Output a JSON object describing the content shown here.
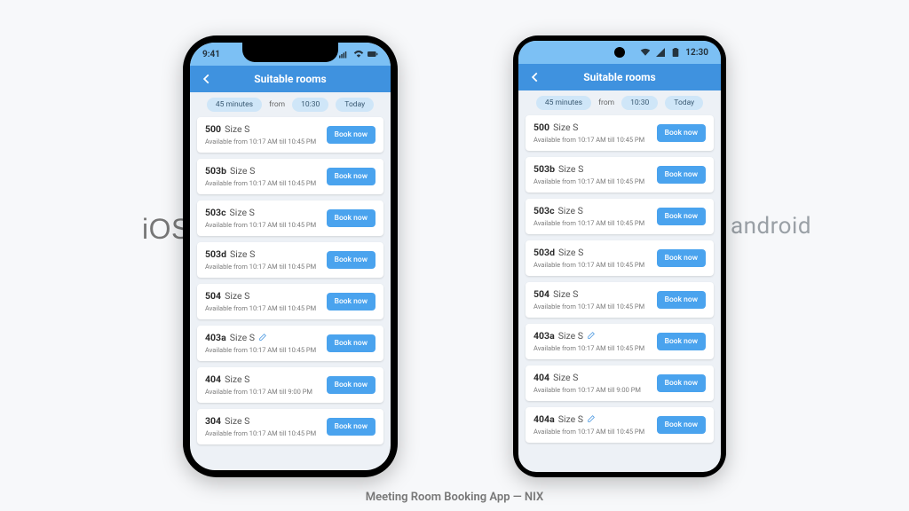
{
  "caption": "Meeting Room Booking App — NIX",
  "platforms": {
    "ios": "iOS",
    "android": "android"
  },
  "ios_status": {
    "time": "9:41"
  },
  "android_status": {
    "time": "12:30"
  },
  "navbar": {
    "title": "Suitable rooms"
  },
  "filters": {
    "duration": "45 minutes",
    "from_label": "from",
    "time": "10:30",
    "day": "Today"
  },
  "book_label": "Book now",
  "rooms_ios": [
    {
      "num": "500",
      "size": "Size S",
      "sub": "Available from 10:17 AM till 10:45 PM",
      "editable": false
    },
    {
      "num": "503b",
      "size": "Size S",
      "sub": "Available from 10:17 AM till 10:45 PM",
      "editable": false
    },
    {
      "num": "503c",
      "size": "Size S",
      "sub": "Available from 10:17 AM till 10:45 PM",
      "editable": false
    },
    {
      "num": "503d",
      "size": "Size S",
      "sub": "Available from 10:17 AM till 10:45 PM",
      "editable": false
    },
    {
      "num": "504",
      "size": "Size S",
      "sub": "Available from 10:17 AM till 10:45 PM",
      "editable": false
    },
    {
      "num": "403a",
      "size": "Size S",
      "sub": "Available from 10:17 AM till 10:45 PM",
      "editable": true
    },
    {
      "num": "404",
      "size": "Size S",
      "sub": "Available from 10:17 AM till 9:00 PM",
      "editable": false
    },
    {
      "num": "304",
      "size": "Size S",
      "sub": "Available from 10:17 AM till 10:45 PM",
      "editable": false
    }
  ],
  "rooms_android": [
    {
      "num": "500",
      "size": "Size S",
      "sub": "Available from 10:17 AM till 10:45 PM",
      "editable": false
    },
    {
      "num": "503b",
      "size": "Size S",
      "sub": "Available from 10:17 AM till 10:45 PM",
      "editable": false
    },
    {
      "num": "503c",
      "size": "Size S",
      "sub": "Available from 10:17 AM till 10:45 PM",
      "editable": false
    },
    {
      "num": "503d",
      "size": "Size S",
      "sub": "Available from 10:17 AM till 10:45 PM",
      "editable": false
    },
    {
      "num": "504",
      "size": "Size S",
      "sub": "Available from 10:17 AM till 10:45 PM",
      "editable": false
    },
    {
      "num": "403a",
      "size": "Size S",
      "sub": "Available from 10:17 AM till 10:45 PM",
      "editable": true
    },
    {
      "num": "404",
      "size": "Size S",
      "sub": "Available from 10:17 AM till 9:00 PM",
      "editable": false
    },
    {
      "num": "404a",
      "size": "Size S",
      "sub": "Available from 10:17 AM till 10:45 PM",
      "editable": true
    }
  ],
  "colors": {
    "accent": "#4aa3ee",
    "header": "#3f92df",
    "status": "#7cc0f4"
  }
}
